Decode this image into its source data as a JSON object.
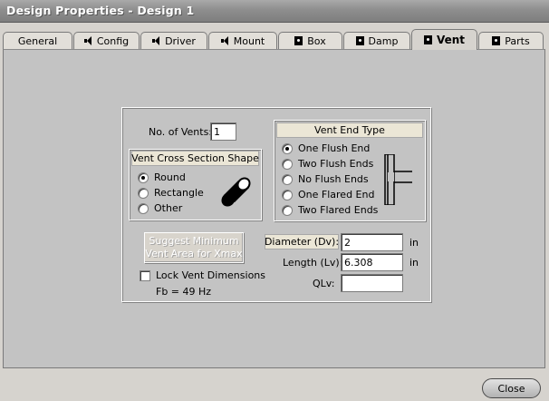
{
  "window": {
    "title": "Design Properties - Design 1"
  },
  "tabs": [
    {
      "label": "General",
      "icon": "none"
    },
    {
      "label": "Config",
      "icon": "speaker-icon"
    },
    {
      "label": "Driver",
      "icon": "speaker-icon"
    },
    {
      "label": "Mount",
      "icon": "speaker-icon"
    },
    {
      "label": "Box",
      "icon": "box-icon"
    },
    {
      "label": "Damp",
      "icon": "box-icon"
    },
    {
      "label": "Vent",
      "icon": "box-icon",
      "active": true
    },
    {
      "label": "Parts",
      "icon": "box-icon"
    }
  ],
  "vent": {
    "num_vents_label": "No. of Vents:",
    "num_vents_value": "1",
    "cross_section": {
      "title": "Vent Cross Section Shape",
      "options": [
        "Round",
        "Rectangle",
        "Other"
      ],
      "selected": "Round"
    },
    "end_type": {
      "title": "Vent End Type",
      "options": [
        "One Flush End",
        "Two Flush Ends",
        "No Flush Ends",
        "One Flared End",
        "Two Flared Ends"
      ],
      "selected": "One Flush End"
    },
    "suggest_button_line1": "Suggest Minimum",
    "suggest_button_line2": "Vent Area for Xmax",
    "lock_label": "Lock Vent Dimensions",
    "lock_checked": false,
    "fb_text": "Fb = 49 Hz",
    "diameter_label": "Diameter (Dv):",
    "diameter_value": "2",
    "diameter_unit": "in",
    "length_label": "Length (Lv):",
    "length_value": "6.308",
    "length_unit": "in",
    "qlv_label": "QLv:",
    "qlv_value": ""
  },
  "footer": {
    "close_label": "Close"
  }
}
